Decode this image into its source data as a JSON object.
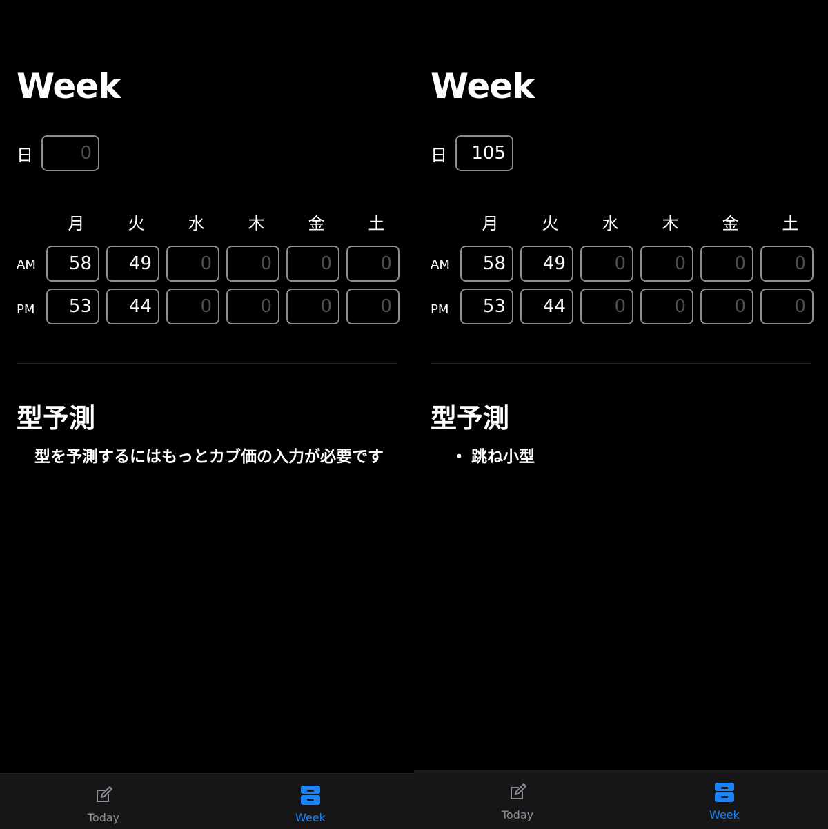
{
  "screens": [
    {
      "title": "Week",
      "sunday": {
        "label": "日",
        "value": "",
        "placeholder": "0"
      },
      "day_headers": [
        "月",
        "火",
        "水",
        "木",
        "金",
        "土"
      ],
      "am": {
        "label": "AM",
        "values": [
          {
            "value": "58",
            "placeholder": "0"
          },
          {
            "value": "49",
            "placeholder": "0"
          },
          {
            "value": "",
            "placeholder": "0"
          },
          {
            "value": "",
            "placeholder": "0"
          },
          {
            "value": "",
            "placeholder": "0"
          },
          {
            "value": "",
            "placeholder": "0"
          }
        ]
      },
      "pm": {
        "label": "PM",
        "values": [
          {
            "value": "53",
            "placeholder": "0"
          },
          {
            "value": "44",
            "placeholder": "0"
          },
          {
            "value": "",
            "placeholder": "0"
          },
          {
            "value": "",
            "placeholder": "0"
          },
          {
            "value": "",
            "placeholder": "0"
          },
          {
            "value": "",
            "placeholder": "0"
          }
        ]
      },
      "prediction": {
        "title": "型予測",
        "message": "型を予測するにはもっとカブ価の入力が必要です"
      },
      "tab_bar": {
        "active": "week",
        "tabs": [
          {
            "id": "today",
            "label": "Today",
            "icon": "compose-icon"
          },
          {
            "id": "week",
            "label": "Week",
            "icon": "archivebox-icon"
          }
        ]
      }
    },
    {
      "title": "Week",
      "sunday": {
        "label": "日",
        "value": "105",
        "placeholder": "0"
      },
      "day_headers": [
        "月",
        "火",
        "水",
        "木",
        "金",
        "土"
      ],
      "am": {
        "label": "AM",
        "values": [
          {
            "value": "58",
            "placeholder": "0"
          },
          {
            "value": "49",
            "placeholder": "0"
          },
          {
            "value": "",
            "placeholder": "0"
          },
          {
            "value": "",
            "placeholder": "0"
          },
          {
            "value": "",
            "placeholder": "0"
          },
          {
            "value": "",
            "placeholder": "0"
          }
        ]
      },
      "pm": {
        "label": "PM",
        "values": [
          {
            "value": "53",
            "placeholder": "0"
          },
          {
            "value": "44",
            "placeholder": "0"
          },
          {
            "value": "",
            "placeholder": "0"
          },
          {
            "value": "",
            "placeholder": "0"
          },
          {
            "value": "",
            "placeholder": "0"
          },
          {
            "value": "",
            "placeholder": "0"
          }
        ]
      },
      "prediction": {
        "title": "型予測",
        "bullet": "・",
        "results": [
          "跳ね小型"
        ]
      },
      "tab_bar": {
        "active": "week",
        "tabs": [
          {
            "id": "today",
            "label": "Today",
            "icon": "compose-icon"
          },
          {
            "id": "week",
            "label": "Week",
            "icon": "archivebox-icon"
          }
        ]
      }
    }
  ],
  "colors": {
    "background": "#000000",
    "tab_bar": "#161618",
    "field_border": "#8d8d92",
    "placeholder_text": "#4d4d52",
    "inactive_tab": "#8e8e93",
    "accent": "#1b82f7"
  }
}
